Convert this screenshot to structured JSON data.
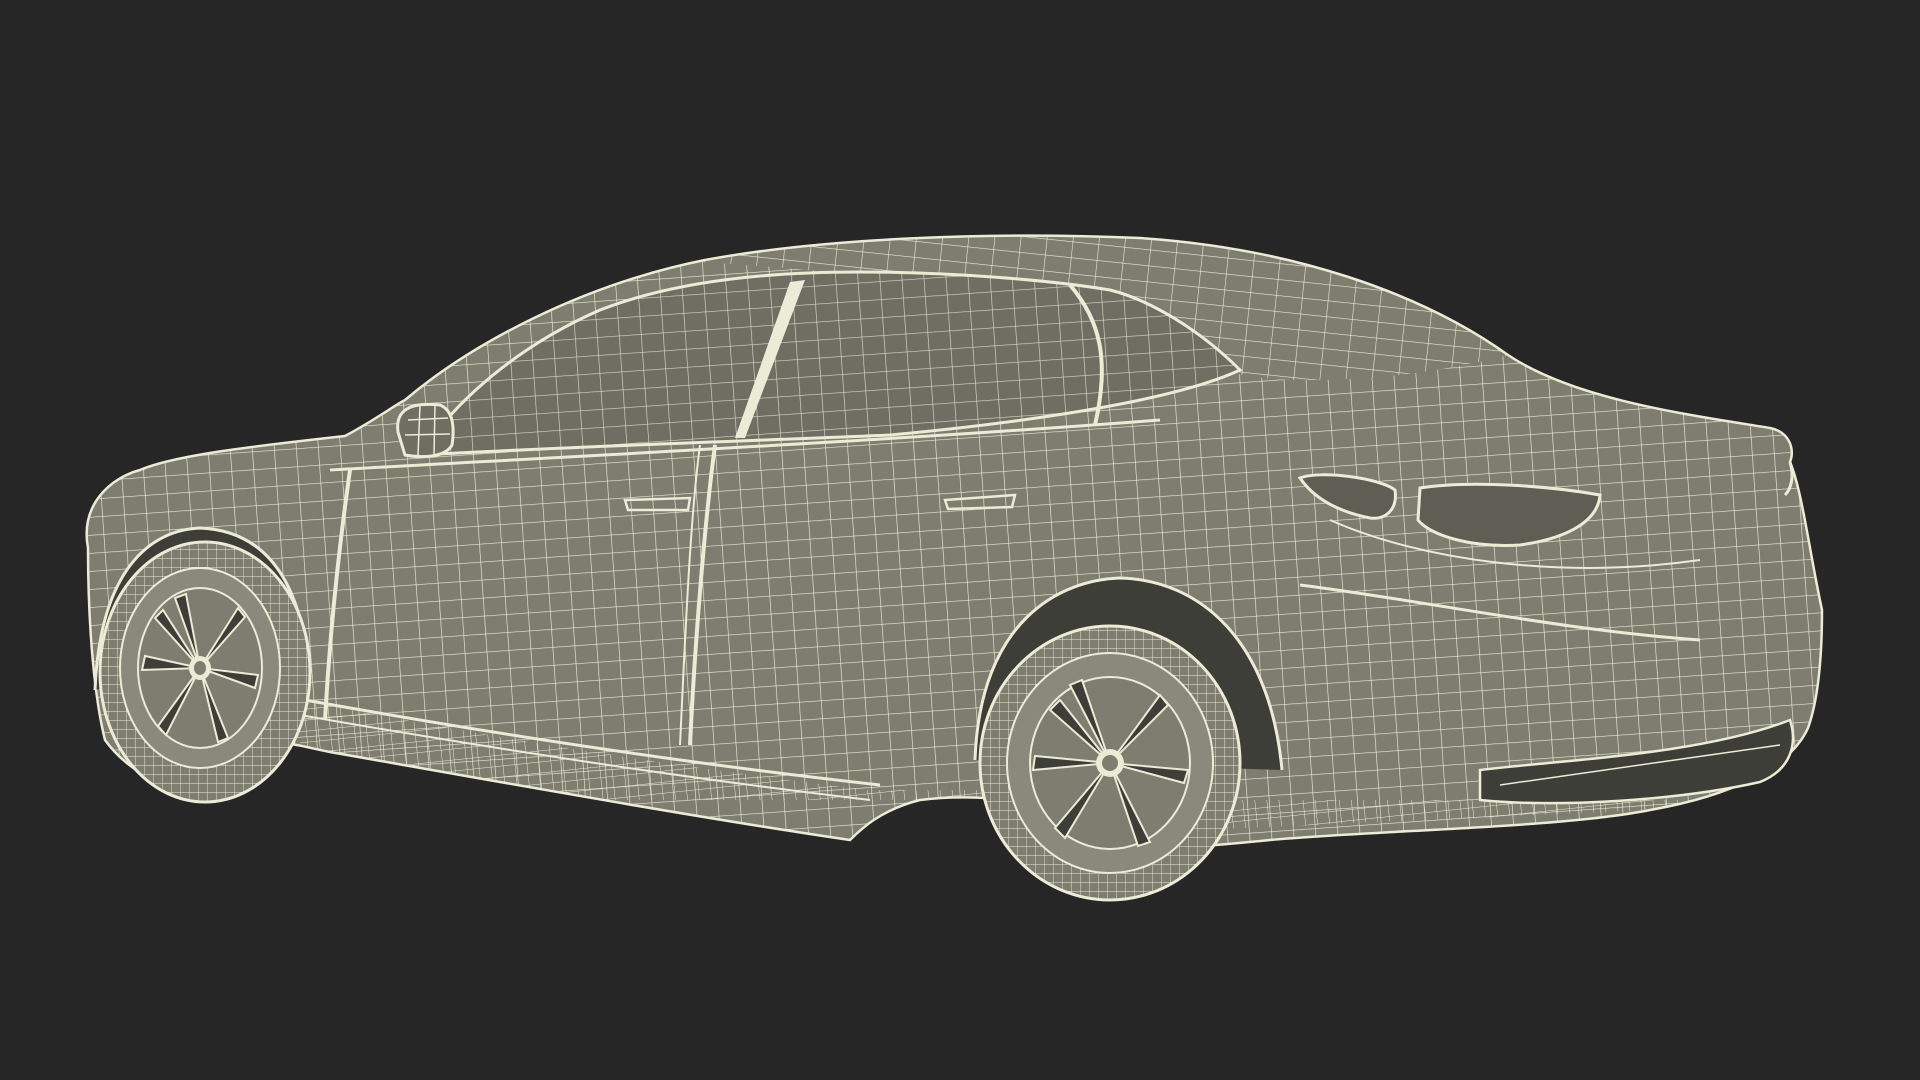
{
  "scene": {
    "background_color": "#262626",
    "body_color": "#7d7d70",
    "wire_color": "#ecebd6",
    "glass_color": "#6e6e62",
    "dark_color": "#3e3e38"
  }
}
